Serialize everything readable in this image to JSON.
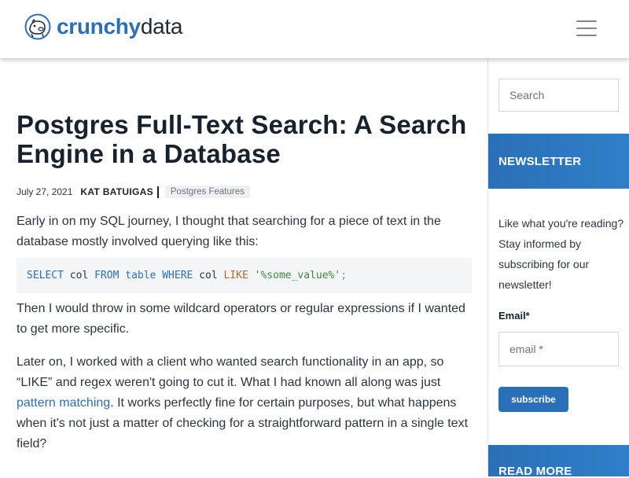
{
  "header": {
    "logo": {
      "brand_bold": "crunchy",
      "brand_light": "data",
      "icon": "hippo-logo-icon"
    },
    "menu_icon": "hamburger-menu-icon"
  },
  "article": {
    "title": "Postgres Full-Text Search: A Search Engine in a Database",
    "date": "July 27, 2021",
    "author": "KAT BATUIGAS",
    "tag": "Postgres Features",
    "intro": "Early in on my SQL journey, I thought that searching for a piece of text in the database mostly involved querying like this:",
    "code": {
      "select": "SELECT",
      "col1": "col",
      "from": "FROM",
      "table": "table",
      "where": "WHERE",
      "col2": "col",
      "like": "LIKE",
      "value": "'%some_value%'",
      "semicolon": ";"
    },
    "para2": "Then I would throw in some wildcard operators or regular expressions if I wanted to get more specific.",
    "para3_before": "Later on, I worked with a client who wanted search functionality in an app, so “LIKE” and regex weren't going to cut it. What I had known all along was just ",
    "para3_link": "pattern matching",
    "para3_after": ". It works perfectly fine for certain purposes, but what happens when it's not just a matter of checking for a straightforward pattern in a single text field?"
  },
  "sidebar": {
    "search_placeholder": "Search",
    "newsletter_heading": "NEWSLETTER",
    "newsletter_text": "Like what you're reading? Stay informed by subscribing for our newsletter!",
    "email_label": "Email*",
    "email_placeholder": "email *",
    "subscribe_label": "subscribe",
    "read_more_heading": "READ MORE"
  },
  "colors": {
    "accent": "#2a70b8",
    "text": "#1f2a36",
    "code_bg": "#f4f5f6"
  }
}
